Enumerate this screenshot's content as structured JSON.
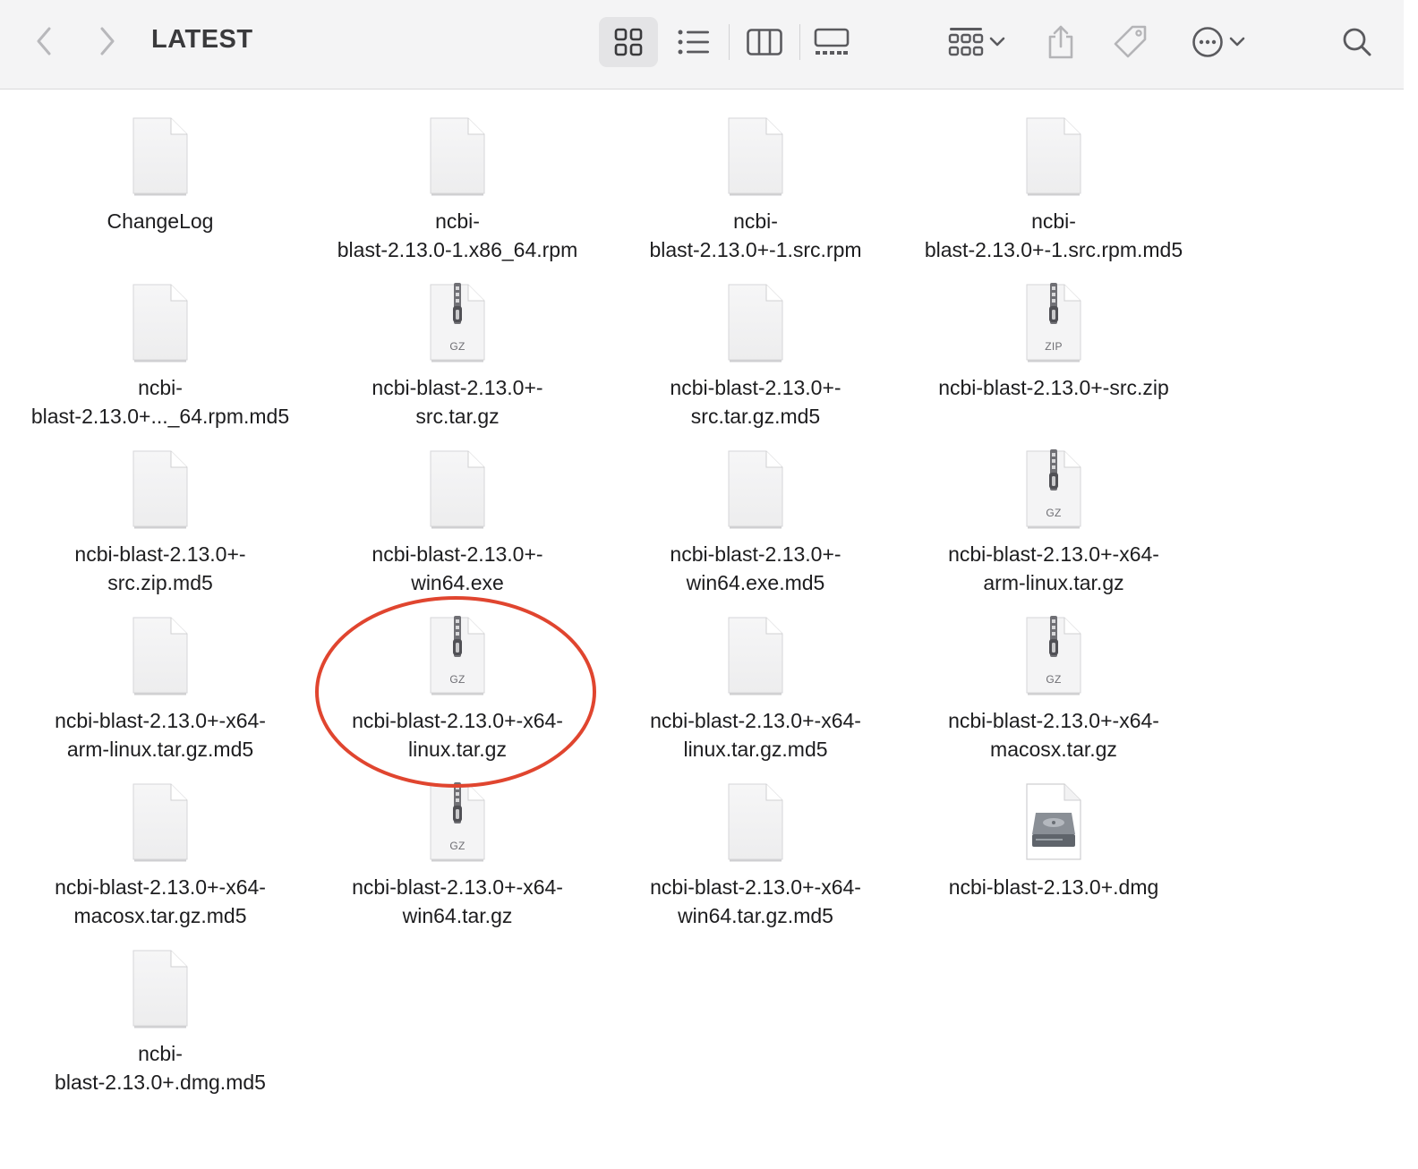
{
  "window": {
    "title": "LATEST"
  },
  "toolbar": {
    "buttons": [
      {
        "name": "back-button",
        "icon": "chevron-left-icon"
      },
      {
        "name": "forward-button",
        "icon": "chevron-right-icon"
      },
      {
        "name": "icon-view-button",
        "icon": "grid-icon",
        "selected": true
      },
      {
        "name": "list-view-button",
        "icon": "list-icon"
      },
      {
        "name": "column-view-button",
        "icon": "columns-icon"
      },
      {
        "name": "gallery-view-button",
        "icon": "gallery-icon"
      },
      {
        "name": "group-by-button",
        "icon": "group-grid-icon"
      },
      {
        "name": "share-button",
        "icon": "share-icon"
      },
      {
        "name": "tag-button",
        "icon": "tag-icon"
      },
      {
        "name": "more-actions-button",
        "icon": "ellipsis-circle-icon"
      },
      {
        "name": "search-button",
        "icon": "search-icon"
      }
    ]
  },
  "files": [
    {
      "label": "ChangeLog",
      "type": "doc",
      "ext": ""
    },
    {
      "label": "ncbi-\nblast-2.13.0-1.x86_64.rpm",
      "type": "doc",
      "ext": ""
    },
    {
      "label": "ncbi-\nblast-2.13.0+-1.src.rpm",
      "type": "doc",
      "ext": ""
    },
    {
      "label": "ncbi-\nblast-2.13.0+-1.src.rpm.md5",
      "type": "doc",
      "ext": ""
    },
    {
      "label": "ncbi-\nblast-2.13.0+..._64.rpm.md5",
      "type": "doc",
      "ext": ""
    },
    {
      "label": "ncbi-blast-2.13.0+-\nsrc.tar.gz",
      "type": "archive",
      "ext": "GZ"
    },
    {
      "label": "ncbi-blast-2.13.0+-\nsrc.tar.gz.md5",
      "type": "doc",
      "ext": ""
    },
    {
      "label": "ncbi-blast-2.13.0+-src.zip",
      "type": "archive",
      "ext": "ZIP"
    },
    {
      "label": "ncbi-blast-2.13.0+-\nsrc.zip.md5",
      "type": "doc",
      "ext": ""
    },
    {
      "label": "ncbi-blast-2.13.0+-\nwin64.exe",
      "type": "doc",
      "ext": ""
    },
    {
      "label": "ncbi-blast-2.13.0+-\nwin64.exe.md5",
      "type": "doc",
      "ext": ""
    },
    {
      "label": "ncbi-blast-2.13.0+-x64-\narm-linux.tar.gz",
      "type": "archive",
      "ext": "GZ"
    },
    {
      "label": "ncbi-blast-2.13.0+-x64-\narm-linux.tar.gz.md5",
      "type": "doc",
      "ext": ""
    },
    {
      "label": "ncbi-blast-2.13.0+-x64-\nlinux.tar.gz",
      "type": "archive",
      "ext": "GZ",
      "highlighted": true
    },
    {
      "label": "ncbi-blast-2.13.0+-x64-\nlinux.tar.gz.md5",
      "type": "doc",
      "ext": ""
    },
    {
      "label": "ncbi-blast-2.13.0+-x64-\nmacosx.tar.gz",
      "type": "archive",
      "ext": "GZ"
    },
    {
      "label": "ncbi-blast-2.13.0+-x64-\nmacosx.tar.gz.md5",
      "type": "doc",
      "ext": ""
    },
    {
      "label": "ncbi-blast-2.13.0+-x64-\nwin64.tar.gz",
      "type": "archive",
      "ext": "GZ"
    },
    {
      "label": "ncbi-blast-2.13.0+-x64-\nwin64.tar.gz.md5",
      "type": "doc",
      "ext": ""
    },
    {
      "label": "ncbi-blast-2.13.0+.dmg",
      "type": "disk-image",
      "ext": ""
    },
    {
      "label": "ncbi-\nblast-2.13.0+.dmg.md5",
      "type": "doc",
      "ext": ""
    }
  ],
  "colors": {
    "toolbar_bg": "#f4f4f5",
    "highlight_ellipse": "#e0452f",
    "icon_gray": "#7a7a7e"
  }
}
